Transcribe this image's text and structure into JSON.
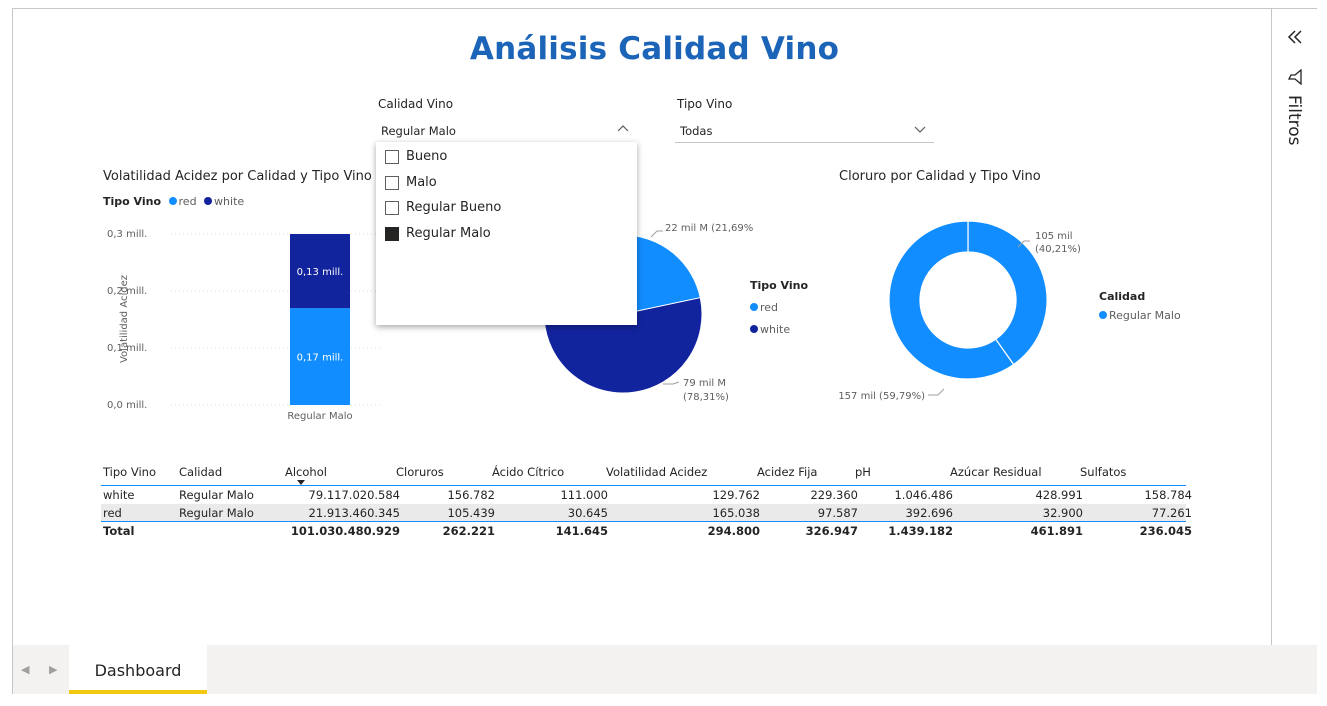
{
  "title": "Análisis Calidad Vino",
  "slicers": {
    "calidad": {
      "label": "Calidad Vino",
      "selected": "Regular Malo",
      "options": [
        {
          "label": "Bueno",
          "checked": false
        },
        {
          "label": "Malo",
          "checked": false
        },
        {
          "label": "Regular Bueno",
          "checked": false
        },
        {
          "label": "Regular Malo",
          "checked": true
        }
      ]
    },
    "tipo": {
      "label": "Tipo Vino",
      "selected": "Todas"
    }
  },
  "colors": {
    "red": "#118dff",
    "white": "#12239e",
    "title": "#1b64b8",
    "accent": "#f2c811"
  },
  "chart_data": [
    {
      "type": "bar",
      "title": "Volatilidad Acidez por Calidad y Tipo Vino",
      "legend_title": "Tipo Vino",
      "legend": [
        "red",
        "white"
      ],
      "ylabel": "Volatilidad Acidez",
      "yticks": [
        "0,0 mill.",
        "0,1 mill.",
        "0,2 mill.",
        "0,3 mill."
      ],
      "ylim": [
        0,
        0.3
      ],
      "categories": [
        "Regular Malo"
      ],
      "series": [
        {
          "name": "red",
          "values": [
            0.17
          ],
          "label": "0,17 mill."
        },
        {
          "name": "white",
          "values": [
            0.13
          ],
          "label": "0,13 mill."
        }
      ]
    },
    {
      "type": "pie",
      "legend_title": "Tipo Vino",
      "legend": [
        "red",
        "white"
      ],
      "slices": [
        {
          "name": "red",
          "value": 21.69,
          "label1": "22 mil M (21,69%)",
          "label2": ""
        },
        {
          "name": "white",
          "value": 78.31,
          "label1": "79 mil M",
          "label2": "(78,31%)"
        }
      ]
    },
    {
      "type": "pie",
      "title": "Cloruro por Calidad y Tipo Vino",
      "legend_title": "Calidad",
      "legend": [
        "Regular Malo"
      ],
      "slices": [
        {
          "name": "105 mil",
          "value": 40.21,
          "label1": "105 mil",
          "label2": "(40,21%)"
        },
        {
          "name": "157 mil",
          "value": 59.79,
          "label1": "157 mil (59,79%)",
          "label2": ""
        }
      ]
    }
  ],
  "table": {
    "headers": [
      "Tipo Vino",
      "Calidad",
      "Alcohol",
      "Cloruros",
      "Ácido Cítrico",
      "Volatilidad Acidez",
      "Acidez Fija",
      "pH",
      "Azúcar Residual",
      "Sulfatos"
    ],
    "rows": [
      [
        "white",
        "Regular Malo",
        "79.117.020.584",
        "156.782",
        "111.000",
        "129.762",
        "229.360",
        "1.046.486",
        "428.991",
        "158.784"
      ],
      [
        "red",
        "Regular Malo",
        "21.913.460.345",
        "105.439",
        "30.645",
        "165.038",
        "97.587",
        "392.696",
        "32.900",
        "77.261"
      ]
    ],
    "total": [
      "Total",
      "",
      "101.030.480.929",
      "262.221",
      "141.645",
      "294.800",
      "326.947",
      "1.439.182",
      "461.891",
      "236.045"
    ]
  },
  "sidebar": {
    "filters_label": "Filtros"
  },
  "tabs": [
    {
      "label": "Dashboard",
      "active": true
    }
  ]
}
